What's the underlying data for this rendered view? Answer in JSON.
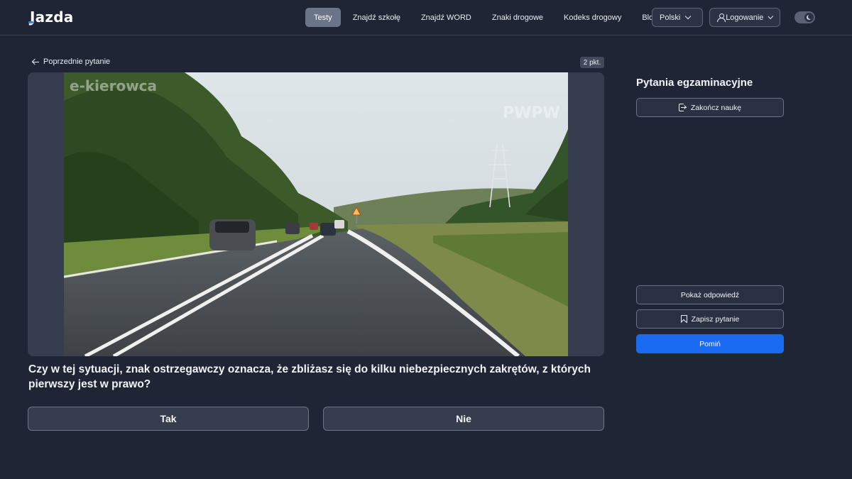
{
  "header": {
    "logo_prefix": "J",
    "logo_rest": "azda",
    "nav": [
      {
        "label": "Testy",
        "active": true
      },
      {
        "label": "Znajdź szkołę",
        "active": false
      },
      {
        "label": "Znajdź WORD",
        "active": false
      },
      {
        "label": "Znaki drogowe",
        "active": false
      },
      {
        "label": "Kodeks drogowy",
        "active": false
      },
      {
        "label": "Blog",
        "active": false
      }
    ],
    "language_label": "Polski",
    "login_label": "Logowanie",
    "icons": {
      "language": "chevron-down-icon",
      "login": "user-icon",
      "theme": "moon-icon"
    }
  },
  "question": {
    "prev_label": "Poprzednie pytanie",
    "points_label": "2 pkt.",
    "media_watermarks": [
      "e-kierowca",
      "PWPW"
    ],
    "text": "Czy w tej sytuacji, znak ostrzegawczy oznacza, że zbliżasz się do kilku niebezpiecznych zakrętów, z których pierwszy jest w prawo?",
    "answers": [
      {
        "label": "Tak"
      },
      {
        "label": "Nie"
      }
    ]
  },
  "sidebar": {
    "title": "Pytania egzaminacyjne",
    "finish_label": "Zakończ naukę",
    "show_answer_label": "Pokaż odpowiedź",
    "save_label": "Zapisz pytanie",
    "skip_label": "Pomiń"
  },
  "colors": {
    "background": "#1f2535",
    "accent": "#1a6bf2",
    "active_nav": "#6a7589"
  }
}
